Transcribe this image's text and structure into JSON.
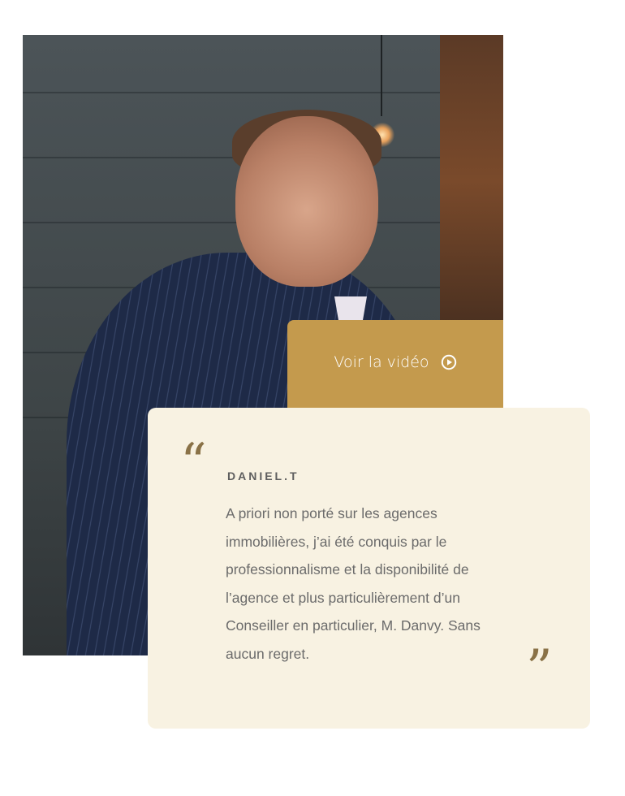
{
  "video": {
    "label": "Voir la vidéo",
    "icon": "play-circle-icon",
    "background": "#c49a4d"
  },
  "testimonial": {
    "author": "DANIEL.T",
    "text": "A priori non porté sur les agences immobilières, j’ai été conquis par le professionnalisme et la disponibilité de l’agence et plus particulièrement d’un Conseiller en particulier, M. Danvy. Sans aucun regret.",
    "quote_open_glyph": "“",
    "quote_close_glyph": "”",
    "card_background": "#f8f2e2",
    "quote_color": "#8a7247"
  },
  "photo": {
    "subject": "portrait-photo"
  }
}
